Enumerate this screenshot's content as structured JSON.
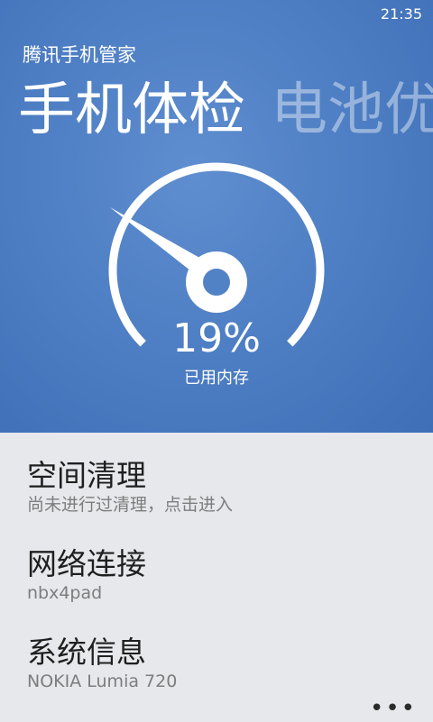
{
  "status_bar": {
    "time": "21:35"
  },
  "app": {
    "title": "腾讯手机管家"
  },
  "pivot": {
    "active": "手机体检",
    "next": "电池优"
  },
  "gauge": {
    "percent_text": "19%",
    "label": "已用内存",
    "value_percent": 19
  },
  "list": {
    "items": [
      {
        "title": "空间清理",
        "subtitle": "尚未进行过清理，点击进入"
      },
      {
        "title": "网络连接",
        "subtitle": "nbx4pad"
      },
      {
        "title": "系统信息",
        "subtitle": "NOKIA Lumia 720"
      }
    ]
  },
  "app_bar": {
    "more": "•••"
  },
  "colors": {
    "hero_blue": "#4f7fc4",
    "list_bg": "#e6e8ec",
    "text_dark": "#1f1f1f",
    "text_gray": "#7d7d7d"
  }
}
